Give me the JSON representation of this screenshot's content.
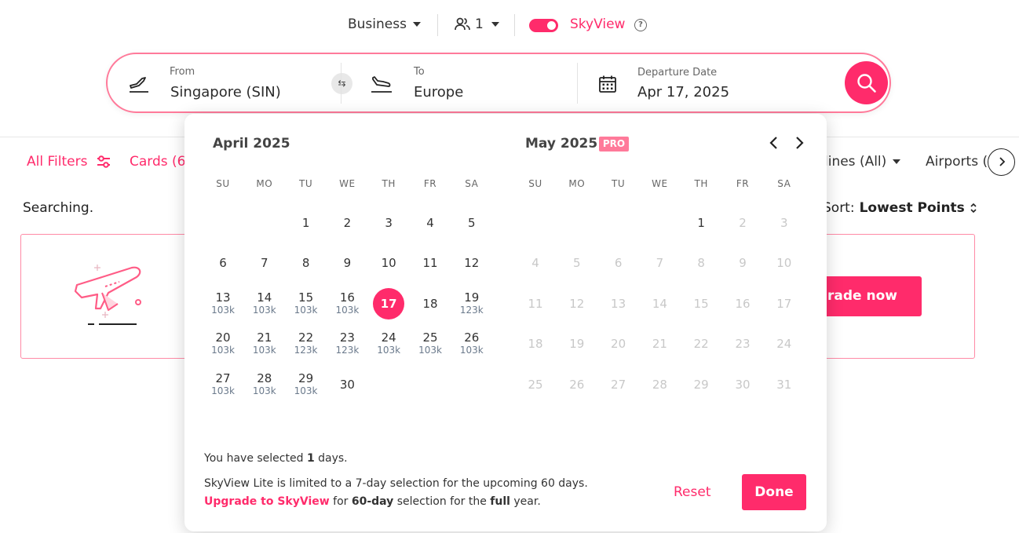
{
  "top": {
    "cabin": "Business",
    "passengers": "1",
    "skyview_label": "SkyView",
    "skyview_enabled": true
  },
  "search": {
    "from_label": "From",
    "from_value": "Singapore (SIN)",
    "to_label": "To",
    "to_value": "Europe",
    "date_label": "Departure Date",
    "date_value": "Apr 17, 2025"
  },
  "filters": {
    "all_filters": "All Filters",
    "cards": "Cards (6",
    "airlines": "lines (All)",
    "airports": "Airports ("
  },
  "status": {
    "searching": "Searching.",
    "sort_label": "Sort:",
    "sort_value": "Lowest Points"
  },
  "promo": {
    "upgrade_button": "rade now"
  },
  "calendar": {
    "weekdays": [
      "SU",
      "MO",
      "TU",
      "WE",
      "TH",
      "FR",
      "SA"
    ],
    "months": [
      {
        "title": "April 2025",
        "pro": "",
        "first_weekday": 2,
        "days": [
          {
            "d": "1",
            "p": ""
          },
          {
            "d": "2",
            "p": ""
          },
          {
            "d": "3",
            "p": ""
          },
          {
            "d": "4",
            "p": ""
          },
          {
            "d": "5",
            "p": ""
          },
          {
            "d": "6",
            "p": ""
          },
          {
            "d": "7",
            "p": ""
          },
          {
            "d": "8",
            "p": ""
          },
          {
            "d": "9",
            "p": ""
          },
          {
            "d": "10",
            "p": ""
          },
          {
            "d": "11",
            "p": ""
          },
          {
            "d": "12",
            "p": ""
          },
          {
            "d": "13",
            "p": "103k"
          },
          {
            "d": "14",
            "p": "103k"
          },
          {
            "d": "15",
            "p": "103k"
          },
          {
            "d": "16",
            "p": "103k"
          },
          {
            "d": "17",
            "p": "",
            "selected": true
          },
          {
            "d": "18",
            "p": ""
          },
          {
            "d": "19",
            "p": "123k"
          },
          {
            "d": "20",
            "p": "103k"
          },
          {
            "d": "21",
            "p": "103k"
          },
          {
            "d": "22",
            "p": "123k"
          },
          {
            "d": "23",
            "p": "123k"
          },
          {
            "d": "24",
            "p": "103k"
          },
          {
            "d": "25",
            "p": "103k"
          },
          {
            "d": "26",
            "p": "103k"
          },
          {
            "d": "27",
            "p": "103k"
          },
          {
            "d": "28",
            "p": "103k"
          },
          {
            "d": "29",
            "p": "103k"
          },
          {
            "d": "30",
            "p": ""
          }
        ]
      },
      {
        "title": "May 2025",
        "pro": "PRO",
        "first_weekday": 4,
        "days": [
          {
            "d": "1",
            "p": ""
          },
          {
            "d": "2",
            "p": "",
            "disabled": true
          },
          {
            "d": "3",
            "p": "",
            "disabled": true
          },
          {
            "d": "4",
            "p": "",
            "disabled": true
          },
          {
            "d": "5",
            "p": "",
            "disabled": true
          },
          {
            "d": "6",
            "p": "",
            "disabled": true
          },
          {
            "d": "7",
            "p": "",
            "disabled": true
          },
          {
            "d": "8",
            "p": "",
            "disabled": true
          },
          {
            "d": "9",
            "p": "",
            "disabled": true
          },
          {
            "d": "10",
            "p": "",
            "disabled": true
          },
          {
            "d": "11",
            "p": "",
            "disabled": true
          },
          {
            "d": "12",
            "p": "",
            "disabled": true
          },
          {
            "d": "13",
            "p": "",
            "disabled": true
          },
          {
            "d": "14",
            "p": "",
            "disabled": true
          },
          {
            "d": "15",
            "p": "",
            "disabled": true
          },
          {
            "d": "16",
            "p": "",
            "disabled": true
          },
          {
            "d": "17",
            "p": "",
            "disabled": true
          },
          {
            "d": "18",
            "p": "",
            "disabled": true
          },
          {
            "d": "19",
            "p": "",
            "disabled": true
          },
          {
            "d": "20",
            "p": "",
            "disabled": true
          },
          {
            "d": "21",
            "p": "",
            "disabled": true
          },
          {
            "d": "22",
            "p": "",
            "disabled": true
          },
          {
            "d": "23",
            "p": "",
            "disabled": true
          },
          {
            "d": "24",
            "p": "",
            "disabled": true
          },
          {
            "d": "25",
            "p": "",
            "disabled": true
          },
          {
            "d": "26",
            "p": "",
            "disabled": true
          },
          {
            "d": "27",
            "p": "",
            "disabled": true
          },
          {
            "d": "28",
            "p": "",
            "disabled": true
          },
          {
            "d": "29",
            "p": "",
            "disabled": true
          },
          {
            "d": "30",
            "p": "",
            "disabled": true
          },
          {
            "d": "31",
            "p": "",
            "disabled": true
          }
        ]
      }
    ],
    "footer": {
      "selected_prefix": "You have selected ",
      "selected_count": "1",
      "selected_suffix": " days.",
      "limit_text": "SkyView Lite is limited to a 7-day selection for the upcoming 60 days.",
      "upgrade_link": "Upgrade to SkyView",
      "upgrade_mid": " for ",
      "upgrade_days": "60-day",
      "upgrade_mid2": " selection for the ",
      "upgrade_full": "full",
      "upgrade_end": " year."
    },
    "reset_label": "Reset",
    "done_label": "Done"
  },
  "colors": {
    "accent": "#ff2b6b",
    "accent_light": "#ff7a9a",
    "points_text": "#6b7a8c",
    "disabled_text": "#c8c8c8"
  }
}
